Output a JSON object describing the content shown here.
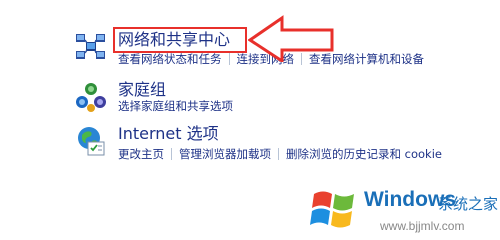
{
  "items": [
    {
      "title": "网络和共享中心",
      "links": [
        "查看网络状态和任务",
        "连接到网络",
        "查看网络计算机和设备"
      ]
    },
    {
      "title": "家庭组",
      "links": [
        "选择家庭组和共享选项"
      ]
    },
    {
      "title": "Internet 选项",
      "links": [
        "更改主页",
        "管理浏览器加载项",
        "删除浏览的历史记录和 cookie"
      ]
    }
  ],
  "watermark": {
    "brand": "Windows",
    "brand_suffix": "系统之家",
    "url": "www.bjjmlv.com"
  },
  "colors": {
    "link": "#1e3287",
    "highlight": "#e8302b",
    "watermark_brand": "#1a6fb8"
  },
  "icons": [
    "network-sharing-icon",
    "homegroup-icon",
    "internet-options-icon",
    "windows-logo-icon"
  ]
}
